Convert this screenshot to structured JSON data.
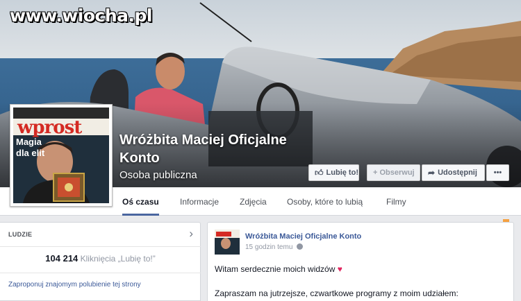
{
  "watermark": "www.wiocha.pl",
  "profile": {
    "name": "Wróżbita Maciej Oficjalne Konto",
    "category": "Osoba publiczna"
  },
  "cover_buttons": {
    "like": "Lubię to!",
    "follow": "+ Obserwuj",
    "share": "Udostępnij",
    "more": "•••"
  },
  "avatar_magazine": {
    "logo": "wprost",
    "headline_1": "Magia",
    "headline_2": "dla elit"
  },
  "tabs": [
    {
      "label": "Oś czasu",
      "active": true
    },
    {
      "label": "Informacje",
      "active": false
    },
    {
      "label": "Zdjęcia",
      "active": false
    },
    {
      "label": "Osoby, które to lubią",
      "active": false
    },
    {
      "label": "Filmy",
      "active": false
    }
  ],
  "people_box": {
    "title": "LUDZIE",
    "likes_count": "104 214",
    "likes_label": "Kliknięcia „Lubię to!”",
    "suggest_link": "Zaproponuj znajomym polubienie tej strony"
  },
  "post": {
    "author": "Wróżbita Maciej Oficjalne Konto",
    "time": "15 godzin temu",
    "text_line_1": "Witam serdecznie moich widzów",
    "heart": "♥",
    "text_line_2": "Zapraszam na jutrzejsze, czwartkowe programy z moim udziałem:"
  },
  "colors": {
    "link": "#3b5998",
    "tab_active": "#4a66a0",
    "page_bg": "#e9eaed",
    "magazine_red": "#d42a23"
  }
}
